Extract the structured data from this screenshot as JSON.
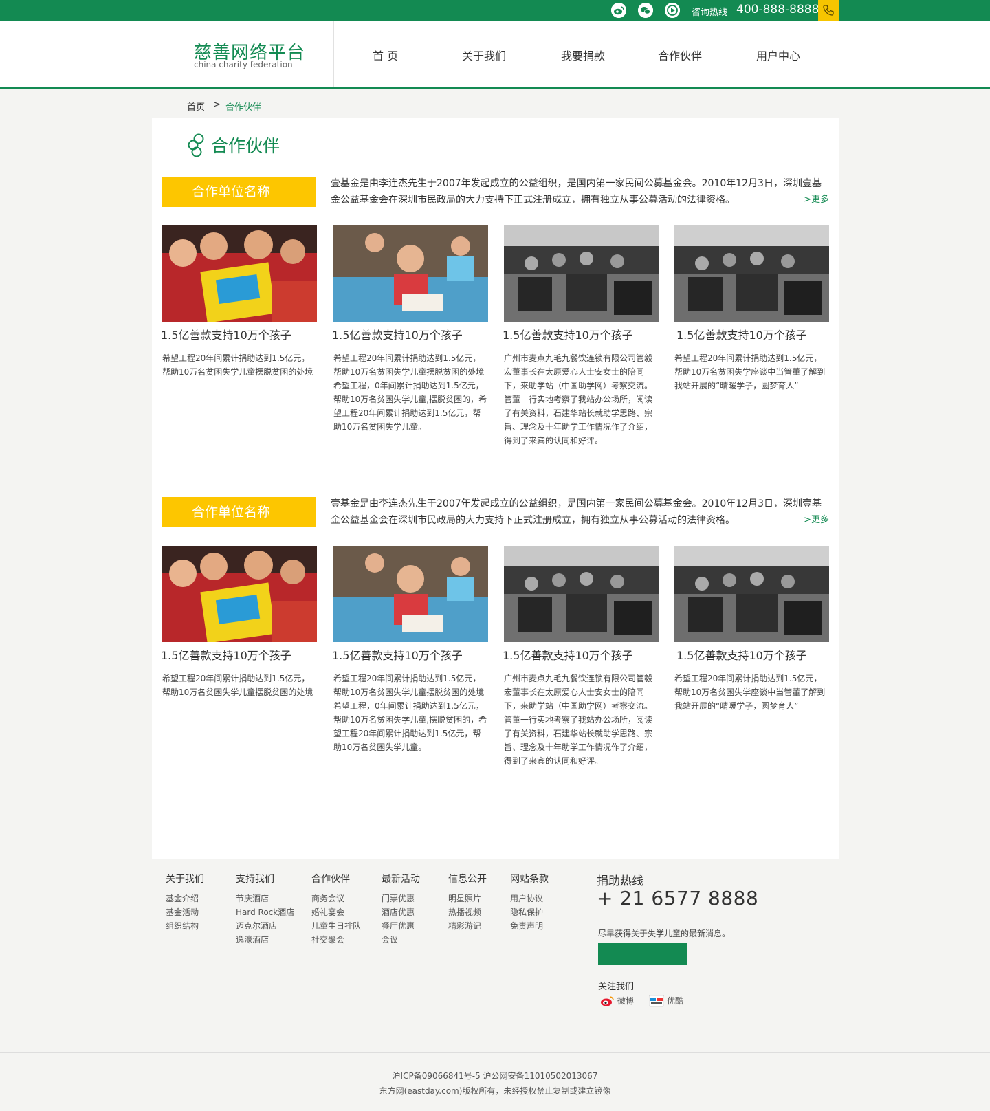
{
  "topbar": {
    "icons": [
      "weibo-icon",
      "wechat-icon",
      "video-icon",
      "phone-icon"
    ],
    "hotline_label": "咨询热线",
    "hotline_number": "400-888-8888"
  },
  "header": {
    "logo_cn": "慈善网络平台",
    "logo_en": "china charity federation",
    "nav": [
      {
        "label": "首  页"
      },
      {
        "label": "关于我们"
      },
      {
        "label": "我要捐款"
      },
      {
        "label": "合作伙伴"
      },
      {
        "label": "用户中心"
      }
    ]
  },
  "breadcrumb": {
    "home": "首页",
    "separator": ">",
    "current": "合作伙伴"
  },
  "page": {
    "title": "合作伙伴"
  },
  "sections": [
    {
      "badge": "合作单位名称",
      "intro": "壹基金是由李连杰先生于2007年发起成立的公益组织，是国内第一家民间公募基金会。2010年12月3日，深圳壹基金公益基金会在深圳市民政局的大力支持下正式注册成立，拥有独立从事公募活动的法律资格。",
      "more": ">更多",
      "cards": [
        {
          "title": "1.5亿善款支持10万个孩子",
          "desc": "希望工程20年间累计捐助达到1.5亿元，帮助10万名贫困失学儿童摆脱贫困的处境"
        },
        {
          "title": "1.5亿善款支持10万个孩子",
          "desc": "希望工程20年间累计捐助达到1.5亿元，帮助10万名贫困失学儿童摆脱贫困的处境希望工程，0年间累计捐助达到1.5亿元，帮助10万名贫困失学儿童,摆脱贫困的，希望工程20年间累计捐助达到1.5亿元，帮助10万名贫困失学儿童。"
        },
        {
          "title": "1.5亿善款支持10万个孩子",
          "desc": "广州市麦点九毛九餐饮连锁有限公司管毅宏董事长在太原爱心人士安女士的陪同下，来助学站（中国助学网）考察交流。管董一行实地考察了我站办公场所，阅读了有关资料，石建华站长就助学思路、宗旨、理念及十年助学工作情况作了介绍，得到了来宾的认同和好评。"
        },
        {
          "title": "1.5亿善款支持10万个孩子",
          "desc": "希望工程20年间累计捐助达到1.5亿元，帮助10万名贫困失学座谈中当管董了解到我站开展的“晴暖学子，圆梦育人”"
        }
      ]
    },
    {
      "badge": "合作单位名称",
      "intro": "壹基金是由李连杰先生于2007年发起成立的公益组织，是国内第一家民间公募基金会。2010年12月3日，深圳壹基金公益基金会在深圳市民政局的大力支持下正式注册成立，拥有独立从事公募活动的法律资格。",
      "more": ">更多",
      "cards": [
        {
          "title": "1.5亿善款支持10万个孩子",
          "desc": "希望工程20年间累计捐助达到1.5亿元，帮助10万名贫困失学儿童摆脱贫困的处境"
        },
        {
          "title": "1.5亿善款支持10万个孩子",
          "desc": "希望工程20年间累计捐助达到1.5亿元，帮助10万名贫困失学儿童摆脱贫困的处境希望工程，0年间累计捐助达到1.5亿元，帮助10万名贫困失学儿童,摆脱贫困的，希望工程20年间累计捐助达到1.5亿元，帮助10万名贫困失学儿童。"
        },
        {
          "title": "1.5亿善款支持10万个孩子",
          "desc": "广州市麦点九毛九餐饮连锁有限公司管毅宏董事长在太原爱心人士安女士的陪同下，来助学站（中国助学网）考察交流。管董一行实地考察了我站办公场所，阅读了有关资料，石建华站长就助学思路、宗旨、理念及十年助学工作情况作了介绍，得到了来宾的认同和好评。"
        },
        {
          "title": "1.5亿善款支持10万个孩子",
          "desc": "希望工程20年间累计捐助达到1.5亿元，帮助10万名贫困失学座谈中当管董了解到我站开展的“晴暖学子，圆梦育人”"
        }
      ]
    }
  ],
  "footer": {
    "columns": [
      {
        "title": "关于我们",
        "links": [
          "基金介绍",
          "基金活动",
          "组织结构"
        ]
      },
      {
        "title": "支持我们",
        "links": [
          "节庆酒店",
          "Hard Rock酒店",
          "迈克尔酒店",
          "逸濠酒店"
        ]
      },
      {
        "title": "合作伙伴",
        "links": [
          "商务会议",
          "婚礼宴会",
          "儿童生日排队",
          "社交聚会"
        ]
      },
      {
        "title": "最新活动",
        "links": [
          "门票优惠",
          "酒店优惠",
          "餐厅优惠",
          "会议"
        ]
      },
      {
        "title": "信息公开",
        "links": [
          "明星照片",
          "热播视频",
          "精彩游记"
        ]
      },
      {
        "title": "网站条款",
        "links": [
          "用户协议",
          "隐私保护",
          "免责声明"
        ]
      }
    ],
    "hotline_title": "捐助热线",
    "hotline": "+ 21 6577 8888",
    "subscribe_text": "尽早获得关于失学儿童的最新消息。",
    "follow_title": "关注我们",
    "social": [
      {
        "icon": "weibo-icon",
        "label": "微博"
      },
      {
        "icon": "youku-icon",
        "label": "优酷"
      }
    ],
    "icp": "沪ICP备09066841号-5    沪公网安备11010502013067",
    "copyright": "东方网(eastday.com)版权所有，未经授权禁止复制或建立镜像"
  },
  "colors": {
    "brand_green": "#138a52",
    "accent_yellow": "#fdc600"
  }
}
